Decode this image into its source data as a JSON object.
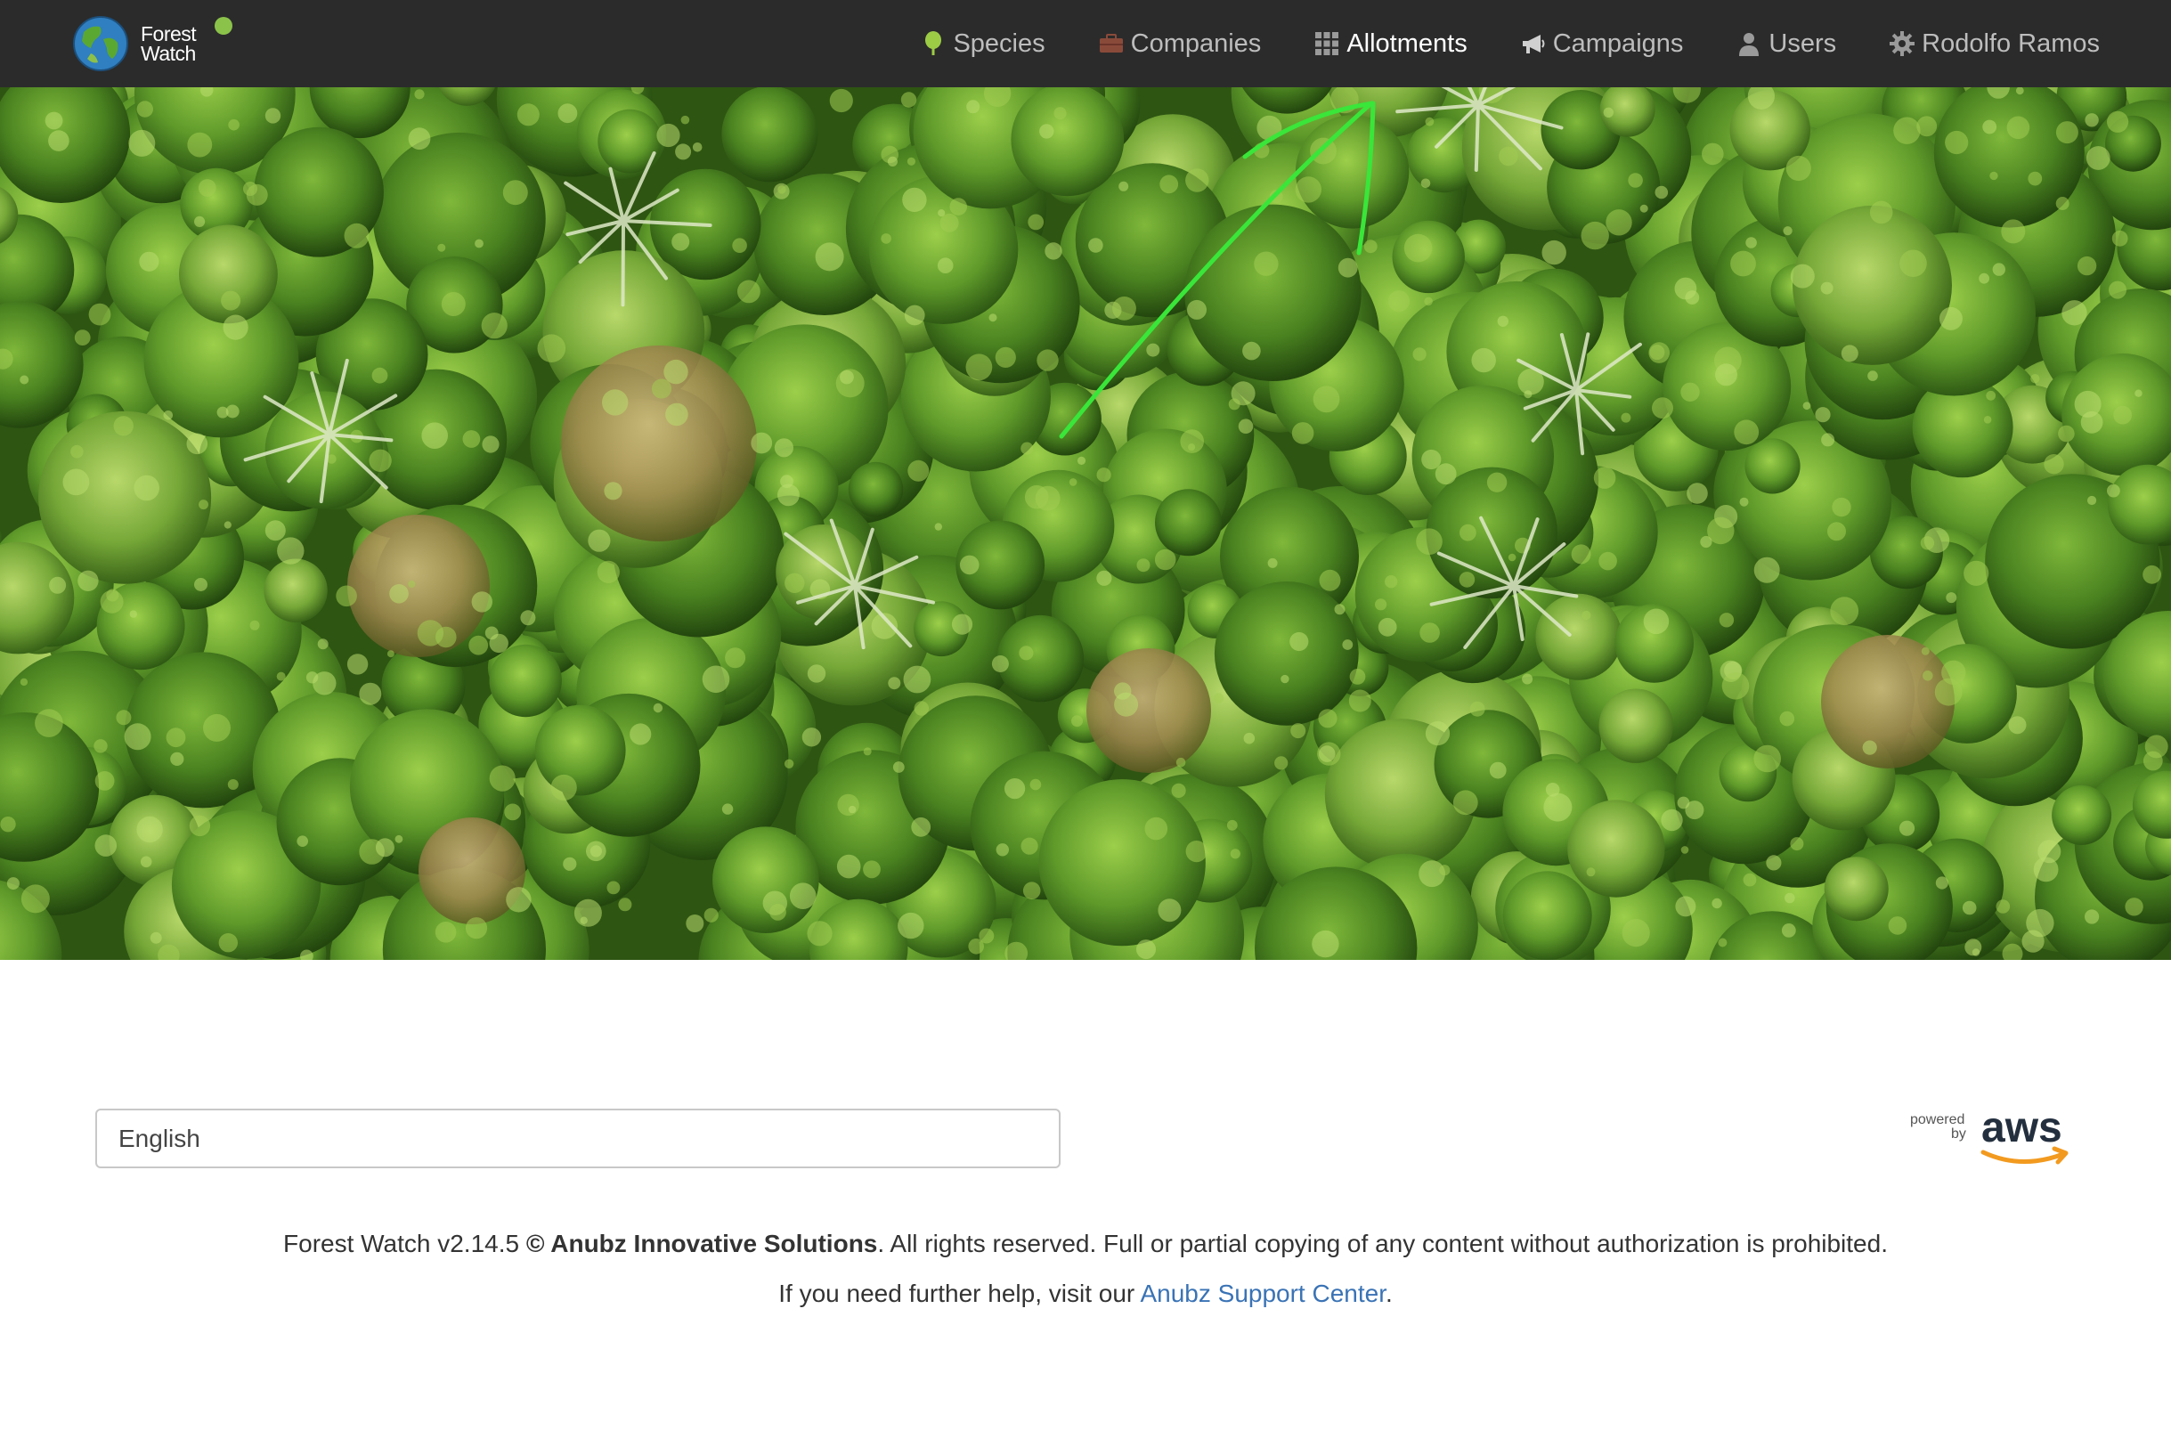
{
  "brand": {
    "line1": "Forest",
    "line2": "Watch",
    "status_color": "#8bc34a"
  },
  "nav": {
    "items": [
      {
        "label": "Species",
        "icon": "tree-icon",
        "active": false
      },
      {
        "label": "Companies",
        "icon": "briefcase-icon",
        "active": false
      },
      {
        "label": "Allotments",
        "icon": "grid-icon",
        "active": true
      },
      {
        "label": "Campaigns",
        "icon": "megaphone-icon",
        "active": false
      },
      {
        "label": "Users",
        "icon": "user-icon",
        "active": false
      },
      {
        "label": "Rodolfo Ramos",
        "icon": "gear-icon",
        "active": false
      }
    ]
  },
  "hero": {
    "image": "aerial forest canopy",
    "annotation": "green-arrow-icon",
    "annotation_color": "#39e639"
  },
  "footer": {
    "language_selected": "English",
    "aws_badge": {
      "powered": "powered",
      "by": "by",
      "brand": "aws"
    },
    "version": "Forest Watch v2.14.5",
    "company": "© Anubz Innovative Solutions",
    "rights": ". All rights reserved. Full or partial copying of any content without authorization is prohibited.",
    "help_prefix": "If you need further help, visit our ",
    "help_link": "Anubz Support Center",
    "help_suffix": "."
  },
  "colors": {
    "navbar_bg": "#2b2b2b",
    "link": "#3a73b5",
    "aws_orange": "#f29a1f"
  }
}
